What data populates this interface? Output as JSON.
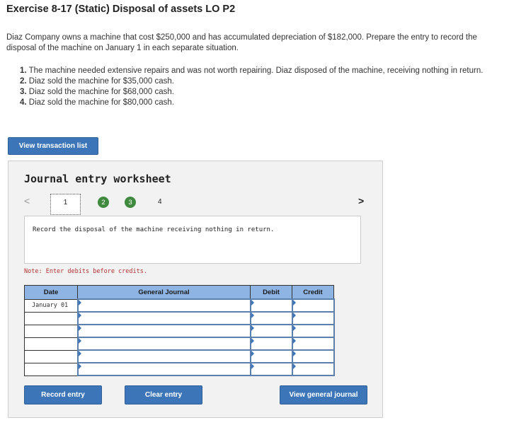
{
  "exercise": {
    "title": "Exercise 8-17 (Static) Disposal of assets LO P2",
    "intro": "Diaz Company owns a machine that cost $250,000 and has accumulated depreciation of $182,000. Prepare the entry to record the disposal of the machine on January 1 in each separate situation.",
    "situations": [
      {
        "num": "1.",
        "text": "The machine needed extensive repairs and was not worth repairing. Diaz disposed of the machine, receiving nothing in return."
      },
      {
        "num": "2.",
        "text": "Diaz sold the machine for $35,000 cash."
      },
      {
        "num": "3.",
        "text": "Diaz sold the machine for $68,000 cash."
      },
      {
        "num": "4.",
        "text": "Diaz sold the machine for $80,000 cash."
      }
    ]
  },
  "view_transaction_list_label": "View transaction list",
  "worksheet": {
    "title": "Journal entry worksheet",
    "prev_glyph": "<",
    "next_glyph": ">",
    "tabs": [
      "1",
      "2",
      "3",
      "4"
    ],
    "instruction": "Record the disposal of the machine receiving nothing in return.",
    "note": "Note: Enter debits before credits.",
    "columns": {
      "date": "Date",
      "journal": "General Journal",
      "debit": "Debit",
      "credit": "Credit"
    },
    "rows": [
      {
        "date": "January 01",
        "account": "",
        "debit": "",
        "credit": ""
      },
      {
        "date": "",
        "account": "",
        "debit": "",
        "credit": ""
      },
      {
        "date": "",
        "account": "",
        "debit": "",
        "credit": ""
      },
      {
        "date": "",
        "account": "",
        "debit": "",
        "credit": ""
      },
      {
        "date": "",
        "account": "",
        "debit": "",
        "credit": ""
      },
      {
        "date": "",
        "account": "",
        "debit": "",
        "credit": ""
      }
    ],
    "buttons": {
      "record": "Record entry",
      "clear": "Clear entry",
      "view_journal": "View general journal"
    },
    "colors": {
      "button": "#3d76b8",
      "header": "#8eb4e3",
      "completed_tab": "#3f8a3f",
      "note": "#b03232"
    }
  }
}
